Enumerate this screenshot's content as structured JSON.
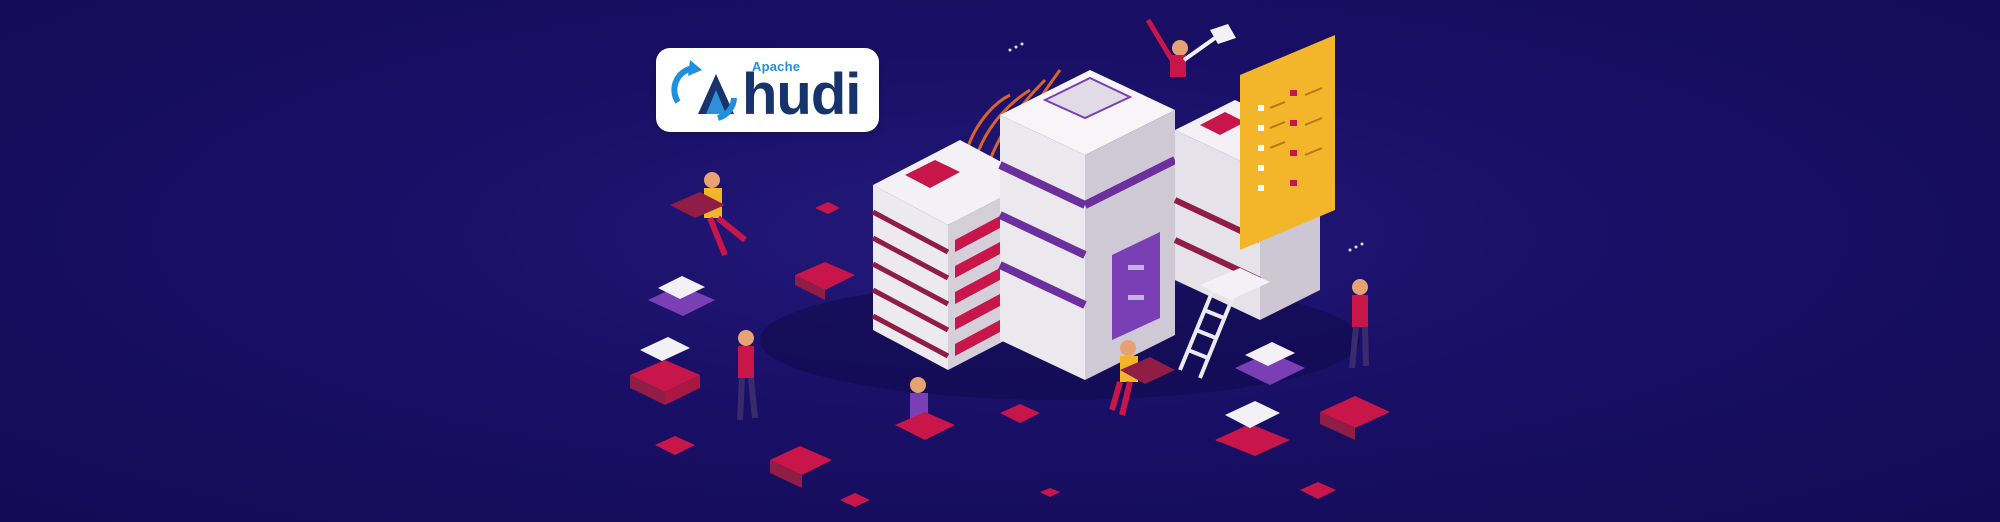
{
  "logo": {
    "superscript": "Apache",
    "wordmark": "hudi"
  },
  "colors": {
    "background": "#190f66",
    "server_white": "#ece9ef",
    "server_shade": "#c9c3cf",
    "accent_crimson": "#c8154a",
    "accent_purple": "#7a3fb5",
    "panel_yellow": "#f3b52a",
    "logo_blue": "#1f8fe0",
    "logo_navy": "#16336b"
  },
  "icons": [
    "hudi-logo-icon",
    "server-rack-icon",
    "box-icon",
    "ladder-icon",
    "person-icon"
  ]
}
